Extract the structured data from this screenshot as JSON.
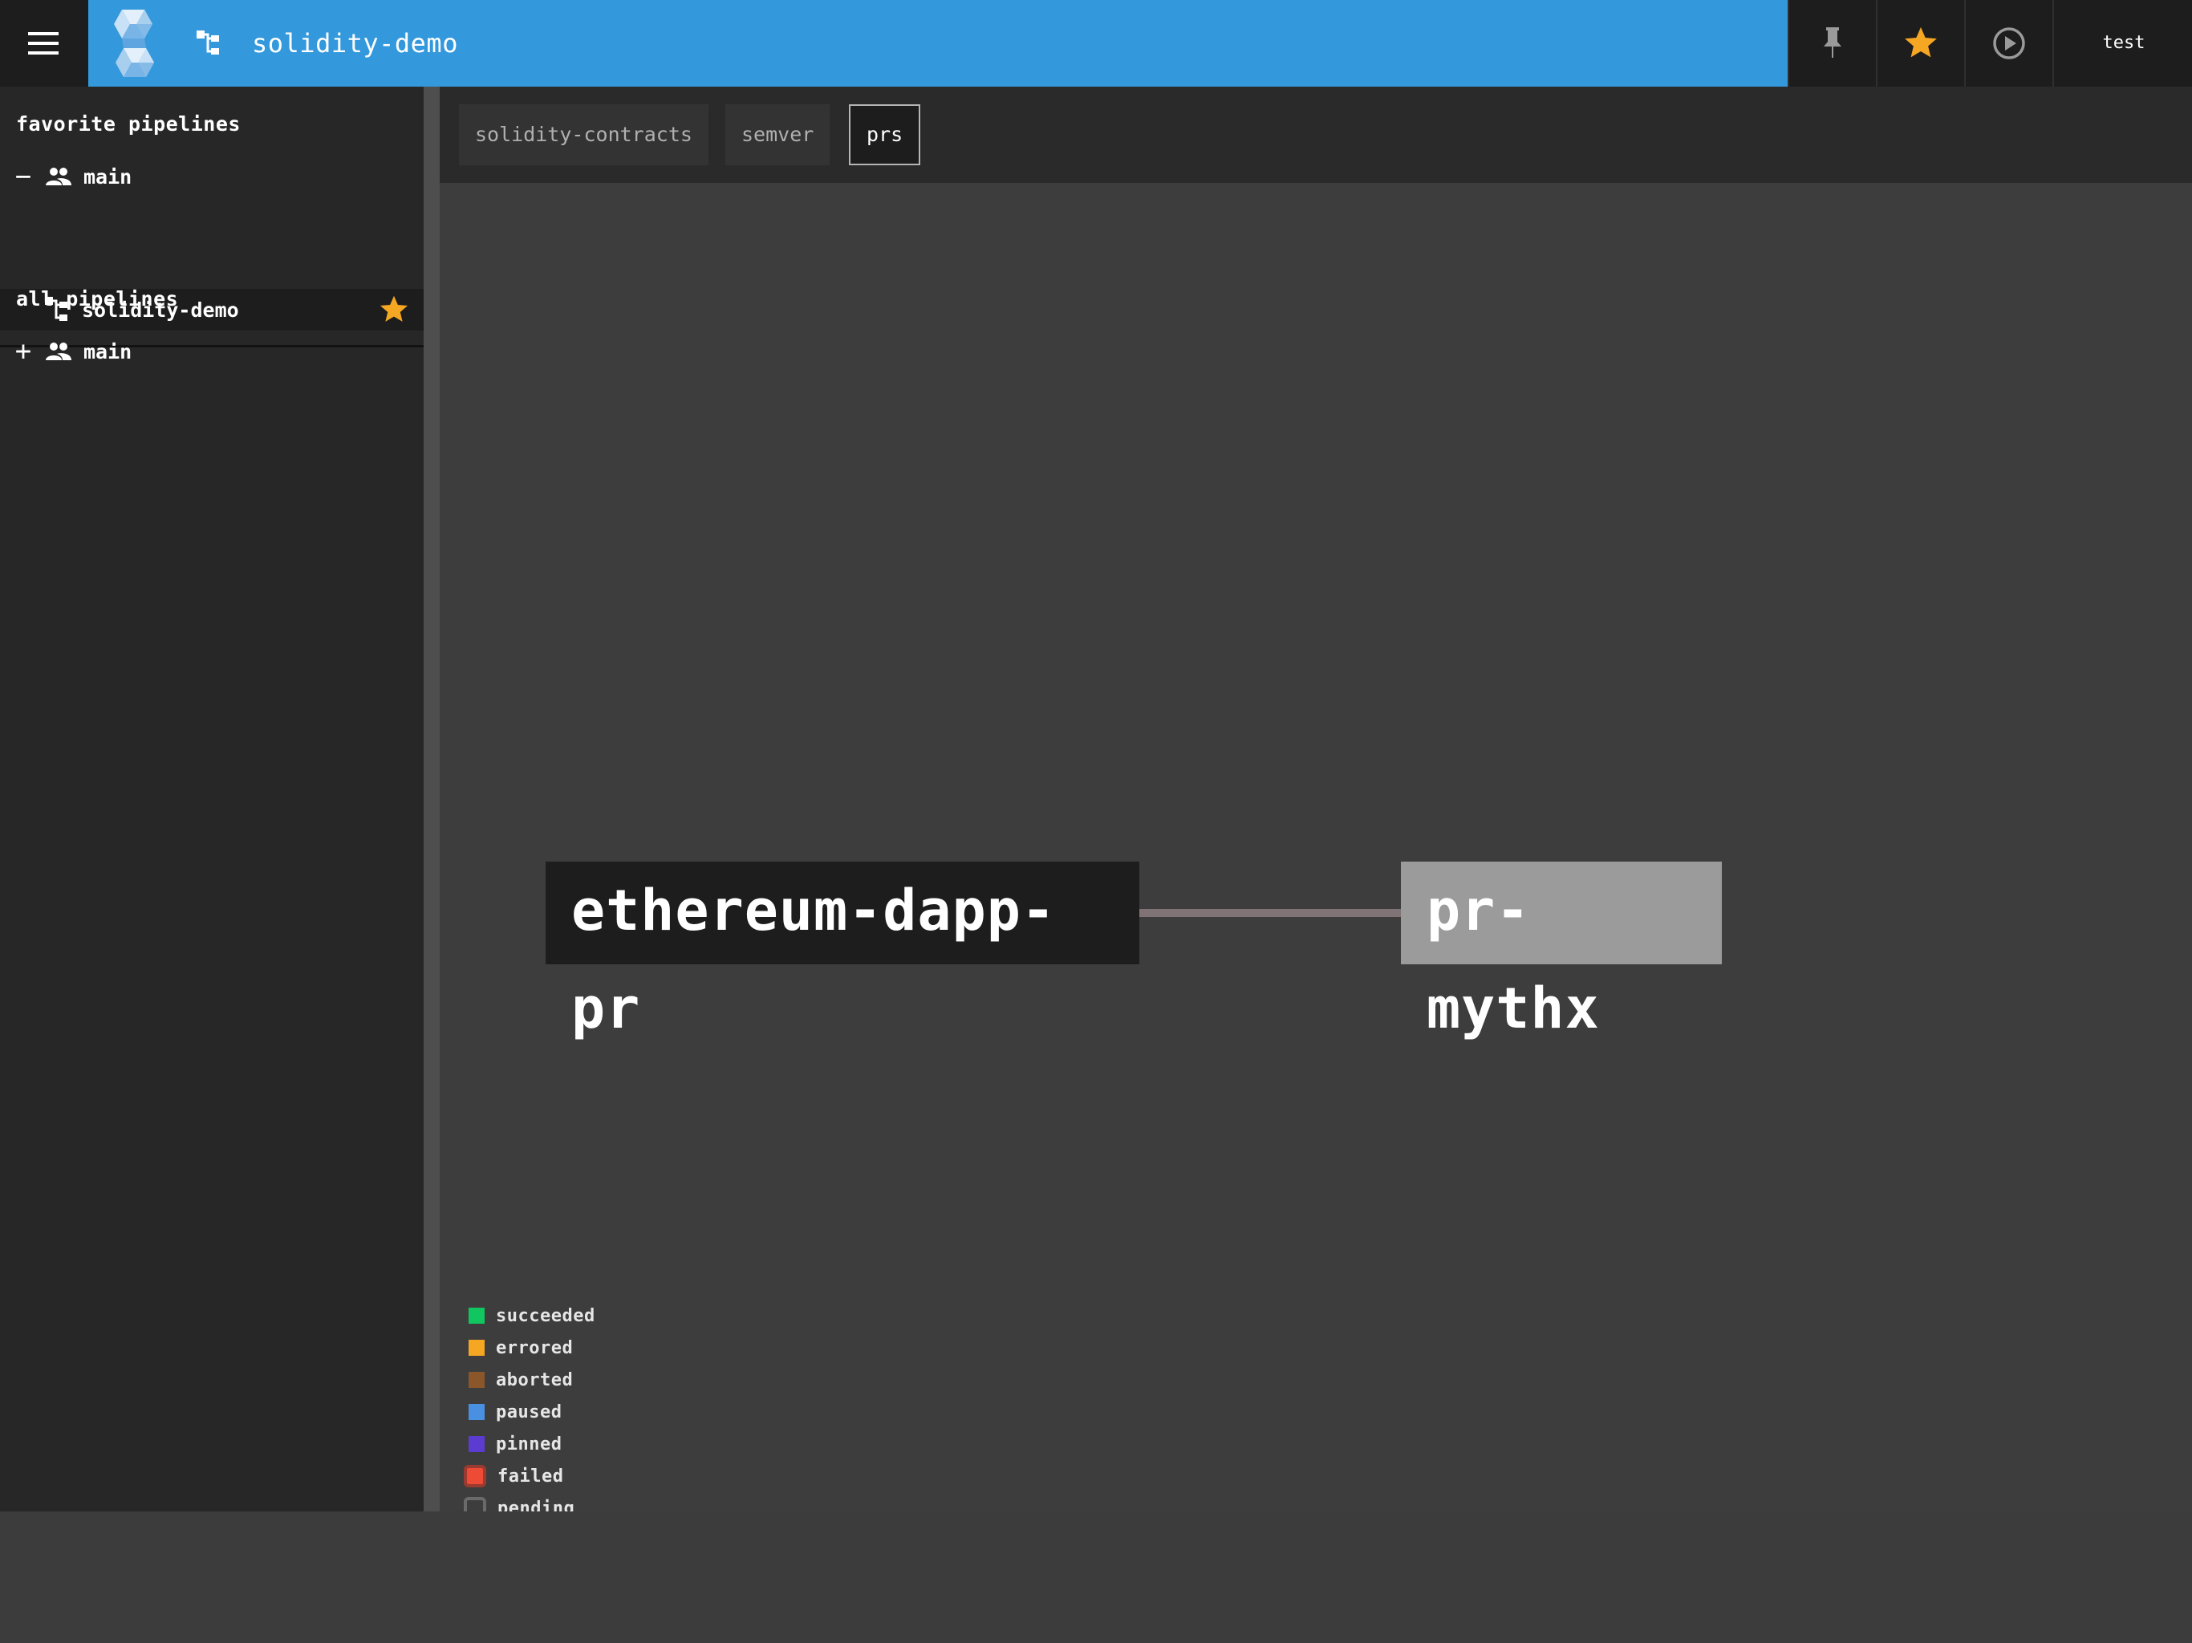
{
  "topbar": {
    "pipeline_name": "solidity-demo",
    "user": "test",
    "star_color": "#f5a623"
  },
  "sidebar": {
    "favorites_heading": "favorite pipelines",
    "favorites": {
      "team": "main",
      "toggle": "−",
      "pipelines": [
        "solidity-demo"
      ]
    },
    "all_heading": "all pipelines",
    "all": {
      "team": "main",
      "toggle": "+"
    }
  },
  "groups": [
    {
      "label": "solidity-contracts",
      "active": false
    },
    {
      "label": "semver",
      "active": false
    },
    {
      "label": "prs",
      "active": true
    }
  ],
  "graph": {
    "jobs": [
      {
        "name": "ethereum-dapp-pr",
        "status": "pending"
      },
      {
        "name": "pr-mythx",
        "status": "paused"
      }
    ]
  },
  "legend": [
    {
      "label": "succeeded",
      "color": "#11c560"
    },
    {
      "label": "errored",
      "color": "#f5a623"
    },
    {
      "label": "aborted",
      "color": "#8b572a"
    },
    {
      "label": "paused",
      "color": "#4a90e2"
    },
    {
      "label": "pinned",
      "color": "#5c3bd1"
    },
    {
      "label": "failed",
      "color": "#ed4b35"
    },
    {
      "label": "pending",
      "color": "#6a6a6a"
    }
  ],
  "icons": {
    "menu": "hamburger-icon",
    "logo": "concourse-logo",
    "pipeline": "pipeline-icon",
    "pin": "pin-icon",
    "favorite": "star-icon",
    "play": "play-circle-icon",
    "team": "team-icon"
  }
}
